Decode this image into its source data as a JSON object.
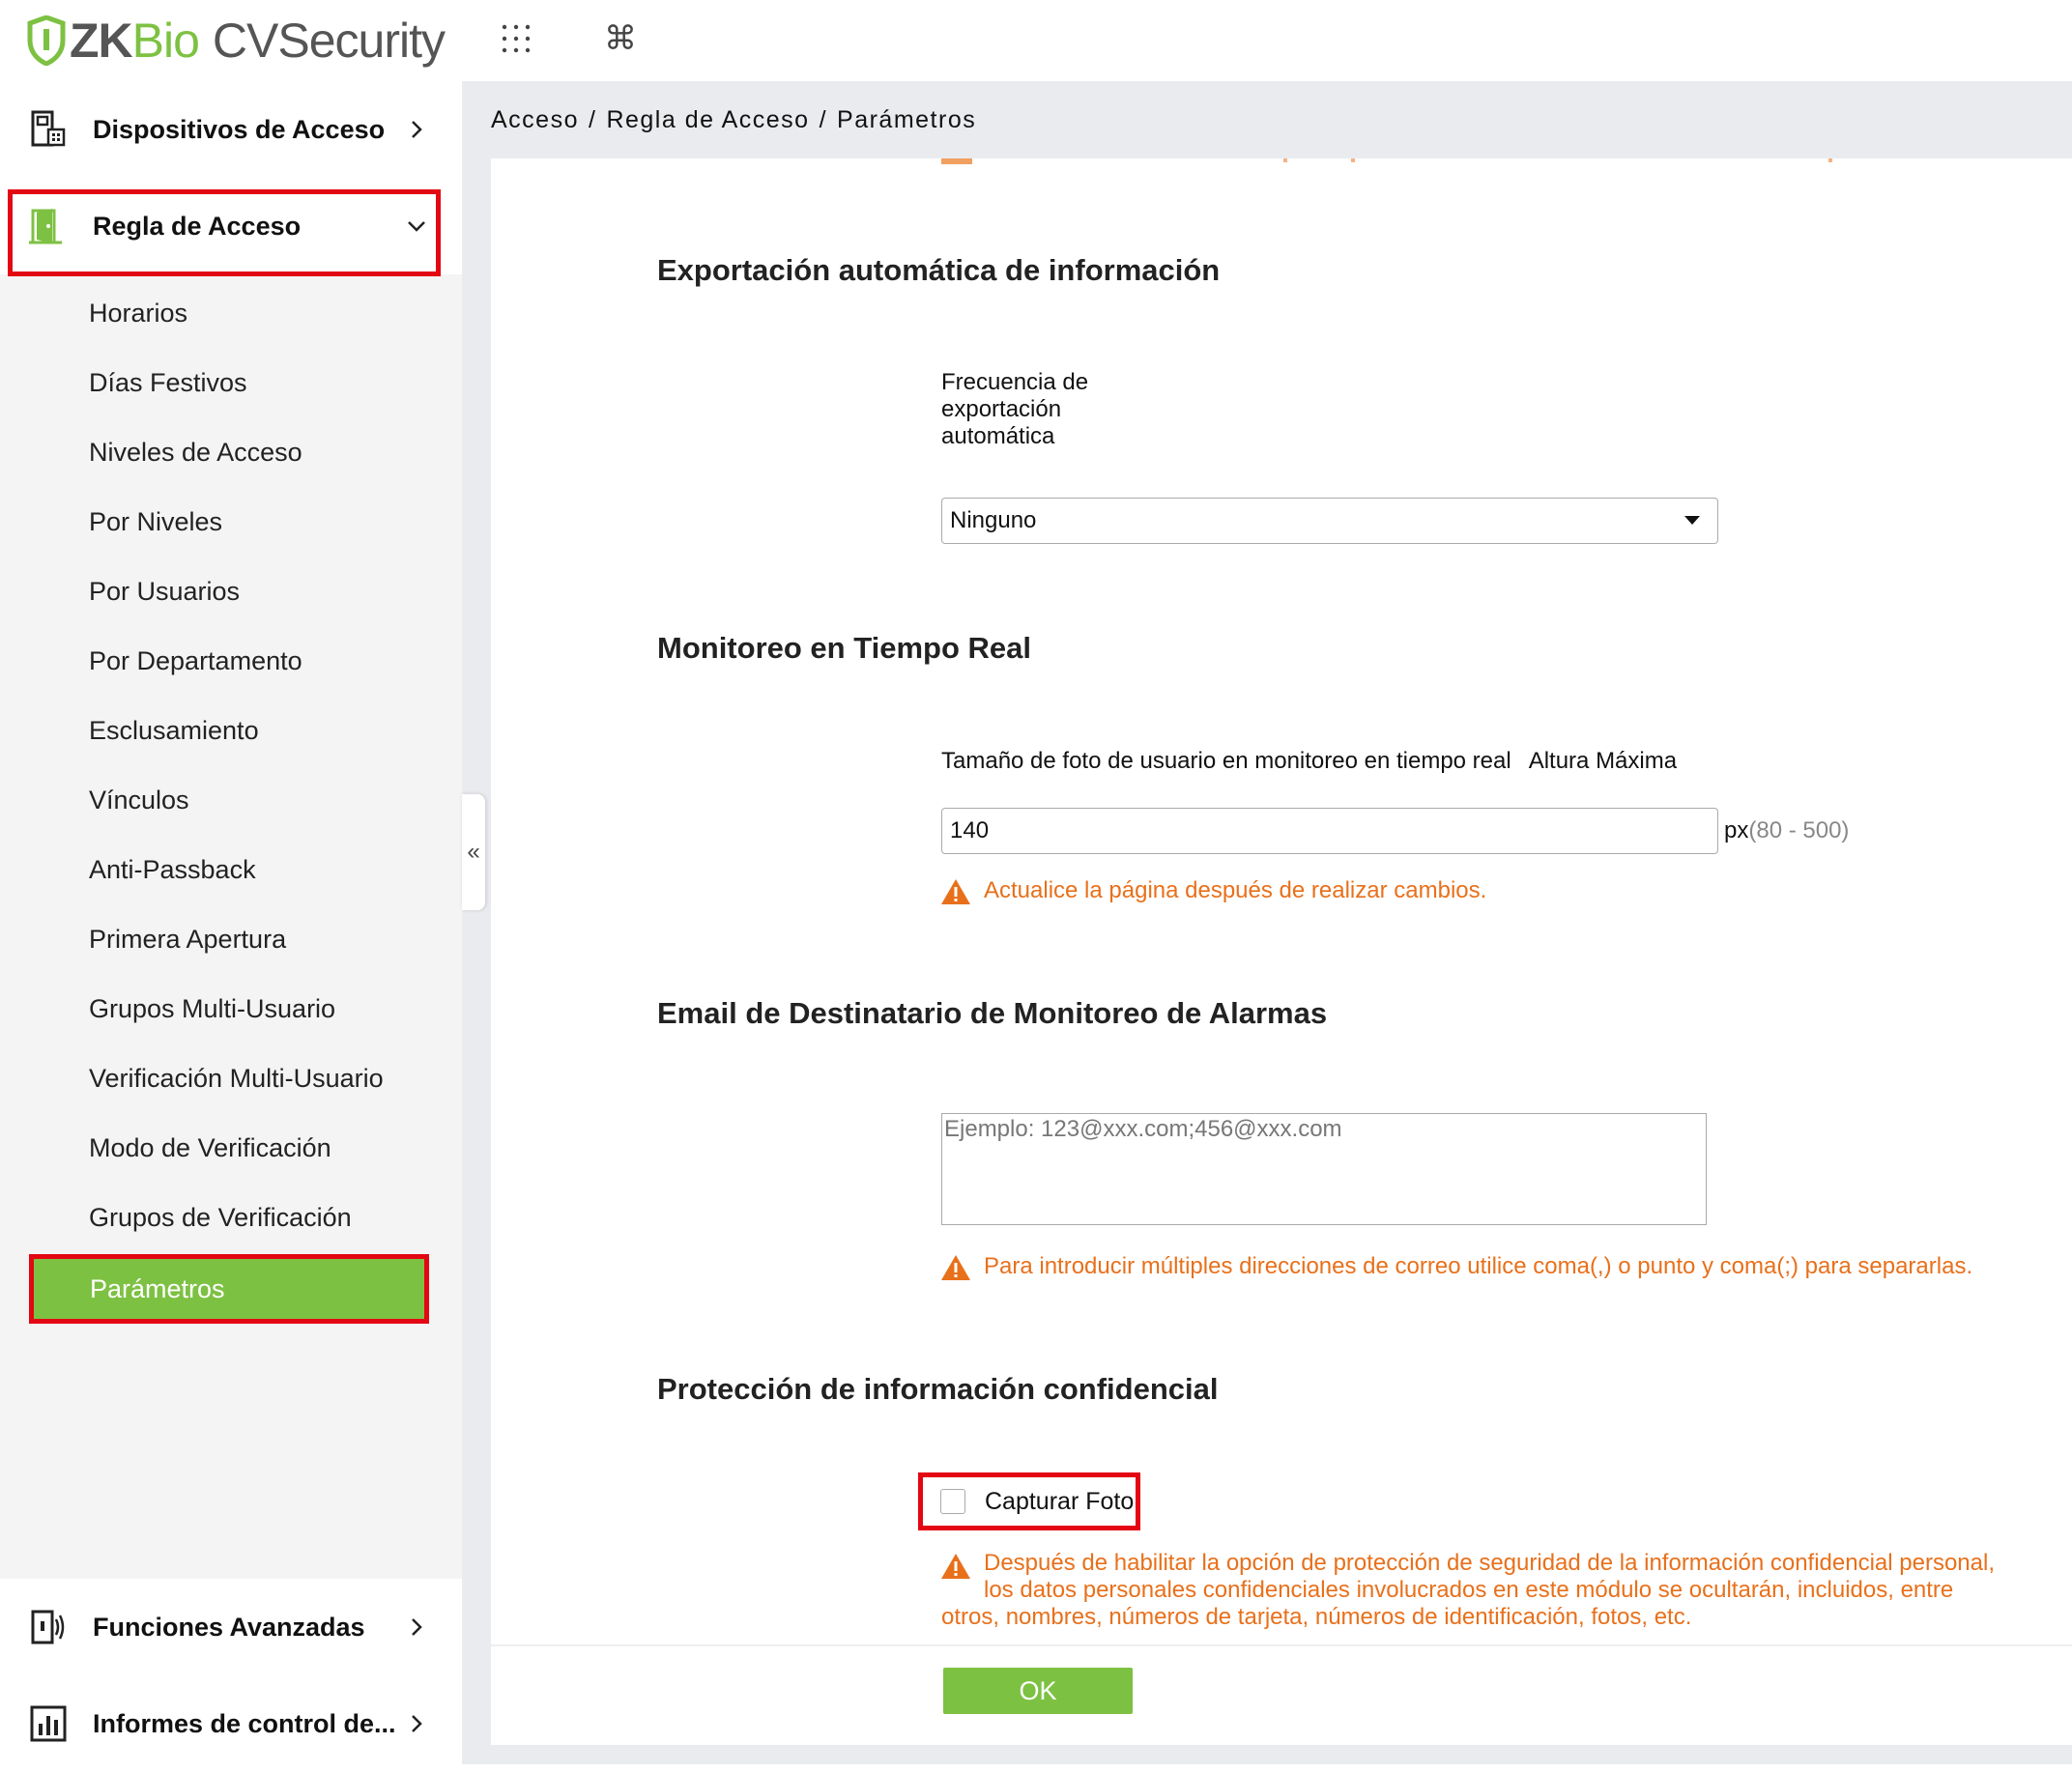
{
  "header": {
    "logo_text_zk": "ZK",
    "logo_text_bio": "Bio",
    "logo_text_cv": "CVSecurity",
    "apps_icon": "grid-dots-icon",
    "command_icon": "command-icon"
  },
  "sidebar": {
    "top_menu": [
      {
        "label": "Dispositivos de Acceso",
        "icon": "device-icon",
        "arrow": "chevron-right"
      },
      {
        "label": "Regla de Acceso",
        "icon": "door-icon",
        "arrow": "chevron-down"
      }
    ],
    "sub_items": [
      "Horarios",
      "Días Festivos",
      "Niveles de Acceso",
      "Por Niveles",
      "Por Usuarios",
      "Por Departamento",
      "Esclusamiento",
      "Vínculos",
      "Anti-Passback",
      "Primera Apertura",
      "Grupos Multi-Usuario",
      "Verificación Multi-Usuario",
      "Modo de Verificación",
      "Grupos de Verificación"
    ],
    "active_item": "Parámetros",
    "bottom_menu": [
      {
        "label": "Funciones Avanzadas",
        "icon": "advanced-icon"
      },
      {
        "label": "Informes de control de...",
        "icon": "report-chart-icon"
      }
    ],
    "collapse_glyph": "«"
  },
  "breadcrumb": {
    "items": [
      "Acceso",
      "Regla de Acceso",
      "Parámetros"
    ],
    "separator": "/"
  },
  "sections": {
    "export": {
      "title": "Exportación automática de información",
      "frequency_label": "Frecuencia de exportación automática",
      "frequency_value": "Ninguno"
    },
    "monitor": {
      "title": "Monitoreo en Tiempo Real",
      "photo_label": "Tamaño de foto de usuario en monitoreo en tiempo real",
      "max_height_label": "Altura Máxima",
      "photo_value": "140",
      "unit": "px",
      "range": "(80 - 500)",
      "warning": "Actualice la página después de realizar cambios."
    },
    "email": {
      "title": "Email de Destinatario de Monitoreo de Alarmas",
      "placeholder": "Ejemplo: 123@xxx.com;456@xxx.com",
      "warning": "Para introducir múltiples direcciones de correo utilice coma(,) o punto y coma(;) para separarlas."
    },
    "privacy": {
      "title": "Protección de información confidencial",
      "checkbox_label": "Capturar Foto",
      "checkbox_checked": false,
      "warning_line1": "Después de habilitar la opción de protección de seguridad de la información confidencial personal,",
      "warning_line2": "los datos personales confidenciales involucrados en este módulo se ocultarán, incluidos, entre",
      "warning_line3": "otros, nombres, números de tarjeta, números de identificación, fotos, etc."
    }
  },
  "footer": {
    "ok_label": "OK"
  },
  "colors": {
    "accent_green": "#7dc142",
    "highlight_red": "#e30613",
    "warning_orange": "#e8701b"
  }
}
